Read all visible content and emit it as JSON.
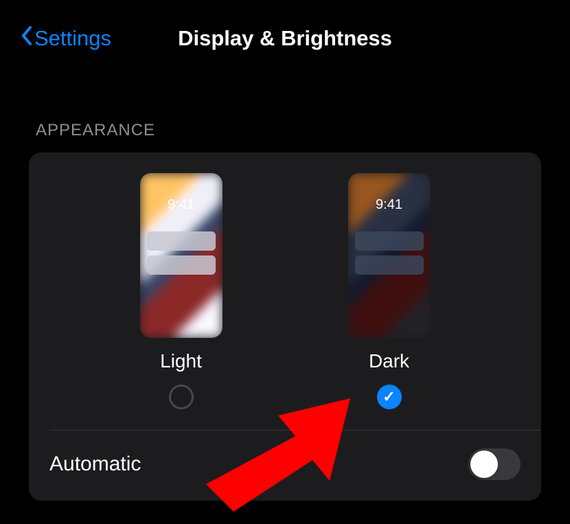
{
  "header": {
    "back_label": "Settings",
    "title": "Display & Brightness"
  },
  "appearance": {
    "section_title": "APPEARANCE",
    "preview_time": "9:41",
    "options": [
      {
        "label": "Light",
        "selected": false
      },
      {
        "label": "Dark",
        "selected": true
      }
    ],
    "automatic_label": "Automatic",
    "automatic_enabled": false
  },
  "colors": {
    "accent": "#0a84ff",
    "background": "#000000",
    "card": "#1c1c1e"
  }
}
